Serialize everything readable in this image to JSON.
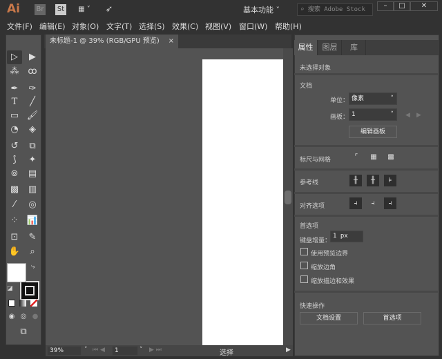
{
  "title_bar": {
    "logo": "Ai",
    "bridge": "Br",
    "stock": "St",
    "workspace": "基本功能",
    "search_placeholder": "搜索 Adobe Stock",
    "minimize": "–",
    "maximize": "□",
    "close": "✕"
  },
  "menu": [
    "文件(F)",
    "编辑(E)",
    "对象(O)",
    "文字(T)",
    "选择(S)",
    "效果(C)",
    "视图(V)",
    "窗口(W)",
    "帮助(H)"
  ],
  "document": {
    "tab_title": "未标题-1 @ 39% (RGB/GPU 预览)",
    "close": "×"
  },
  "status": {
    "zoom": "39%",
    "artboard": "1",
    "tool": "选择"
  },
  "panel": {
    "tabs": [
      "属性",
      "图层",
      "库"
    ],
    "no_selection": "未选择对象",
    "doc_section": "文档",
    "unit_label": "单位：",
    "unit_value": "像素",
    "artboard_label": "画板：",
    "artboard_value": "1",
    "edit_artboards": "编辑画板",
    "rulers_grids": "标尺与网格",
    "guides": "参考线",
    "align_options": "对齐选项",
    "preferences": "首选项",
    "keyboard_increment_label": "键盘增量：",
    "keyboard_increment_value": "1 px",
    "checkboxes": [
      {
        "label": "使用预览边界",
        "checked": false
      },
      {
        "label": "缩放边角",
        "checked": false
      },
      {
        "label": "缩放描边和效果",
        "checked": false
      }
    ],
    "quick_actions": "快速操作",
    "doc_setup": "文档设置",
    "prefs_button": "首选项"
  }
}
